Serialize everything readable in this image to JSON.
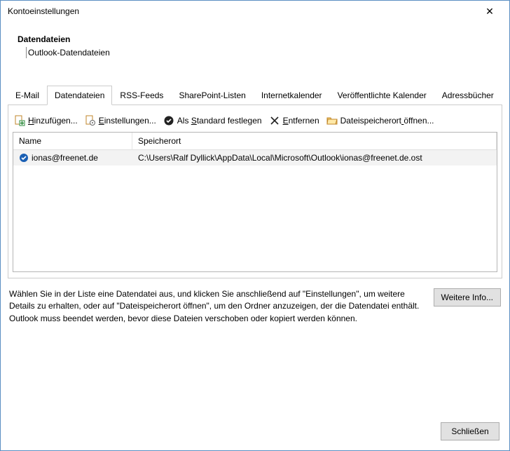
{
  "window": {
    "title": "Kontoeinstellungen"
  },
  "header": {
    "title": "Datendateien",
    "subtitle": "Outlook-Datendateien"
  },
  "tabs": {
    "items": [
      {
        "label": "E-Mail"
      },
      {
        "label": "Datendateien"
      },
      {
        "label": "RSS-Feeds"
      },
      {
        "label": "SharePoint-Listen"
      },
      {
        "label": "Internetkalender"
      },
      {
        "label": "Veröffentlichte Kalender"
      },
      {
        "label": "Adressbücher"
      }
    ],
    "active_index": 1
  },
  "toolbar": {
    "add": "Hinzufügen...",
    "settings": "Einstellungen...",
    "set_default": "Als Standard festlegen",
    "remove": "Entfernen",
    "open_location": "Dateispeicherort öffnen..."
  },
  "listview": {
    "columns": {
      "name": "Name",
      "location": "Speicherort"
    },
    "rows": [
      {
        "name": "ionas@freenet.de",
        "location": "C:\\Users\\Ralf Dyllick\\AppData\\Local\\Microsoft\\Outlook\\ionas@freenet.de.ost",
        "is_default": true
      }
    ]
  },
  "info": {
    "text": "Wählen Sie in der Liste eine Datendatei aus, und klicken Sie anschließend auf \"Einstellungen\", um weitere Details zu erhalten, oder auf \"Dateispeicherort öffnen\", um den Ordner anzuzeigen, der die Datendatei enthält. Outlook muss beendet werden, bevor diese Dateien verschoben oder kopiert werden können.",
    "more_info_btn": "Weitere Info..."
  },
  "footer": {
    "close_btn": "Schließen"
  },
  "underline_map": {
    "Hinzufügen...": 0,
    "Einstellungen...": 0,
    "Als Standard festlegen": 4,
    "Entfernen": 0,
    "Dateispeicherort öffnen...": 16,
    "Weitere Info...": 0,
    "Schließen": 0
  }
}
